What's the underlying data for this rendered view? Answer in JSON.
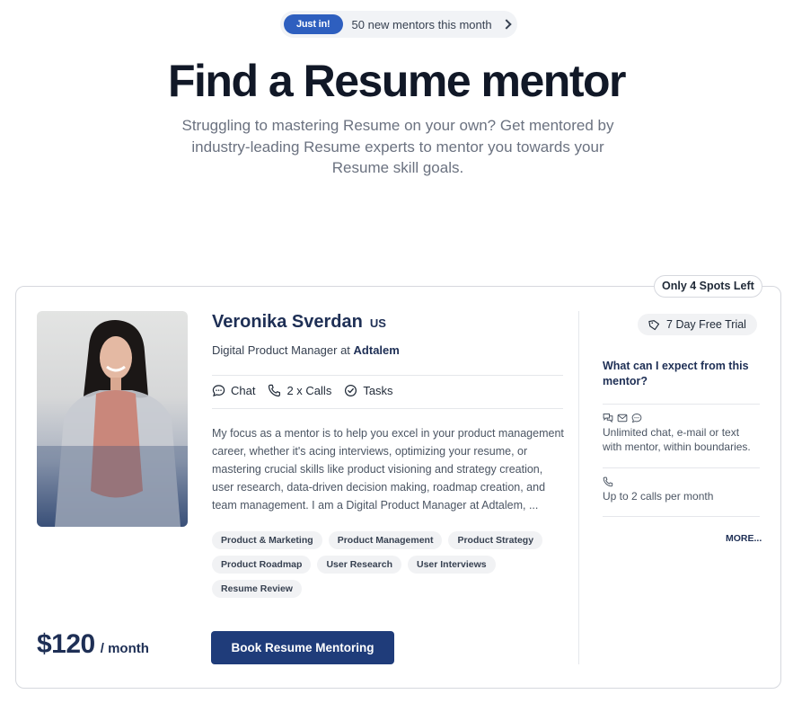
{
  "announcement": {
    "badge": "Just in!",
    "message": "50 new mentors this month",
    "icon": "chevron-right-icon"
  },
  "hero": {
    "title": "Find a Resume mentor",
    "subtitle": "Struggling to mastering Resume on your own? Get mentored by industry-leading Resume experts to mentor you towards your Resume skill goals."
  },
  "mentor": {
    "spots_badge": "Only 4 Spots Left",
    "name": "Veronika Sverdan",
    "country": "US",
    "role_prefix": "Digital Product Manager at ",
    "company": "Adtalem",
    "features": [
      {
        "icon": "chat-icon",
        "label": "Chat"
      },
      {
        "icon": "phone-icon",
        "label": "2 x Calls"
      },
      {
        "icon": "check-circle-icon",
        "label": "Tasks"
      }
    ],
    "bio": "My focus as a mentor is to help you excel in your product management career, whether it's acing interviews, optimizing your resume, or mastering crucial skills like product visioning and strategy creation, user research, data-driven decision making, roadmap creation, and team management. I am a Digital Product Manager at Adtalem, ...",
    "tags": [
      "Product & Marketing",
      "Product Management",
      "Product Strategy",
      "Product Roadmap",
      "User Research",
      "User Interviews",
      "Resume Review"
    ],
    "price": "$120",
    "price_period": "/ month",
    "book_button": "Book Resume Mentoring",
    "trial_badge": "7 Day Free Trial",
    "expect_title": "What can I expect from this mentor?",
    "expect_items": [
      {
        "icons": [
          "chat-bubbles-icon",
          "mail-icon",
          "message-icon"
        ],
        "text": "Unlimited chat, e-mail or text with mentor, within boundaries."
      },
      {
        "icons": [
          "phone-icon"
        ],
        "text": "Up to 2 calls per month"
      }
    ],
    "more_link": "MORE..."
  }
}
